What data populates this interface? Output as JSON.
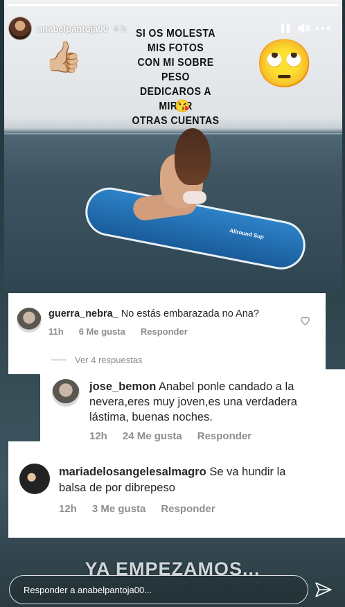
{
  "story": {
    "username": "anabelpantoja00",
    "time": "4 h",
    "caption_lines": [
      "SI OS MOLESTA",
      "MIS FOTOS",
      "CON MI SOBRE PESO",
      "DEDICAROS A MIRAR",
      "OTRAS CUENTAS"
    ],
    "emoji_kiss": "😘",
    "emoji_thumb": "👍🏼",
    "emoji_eyes": "🙄",
    "board_text": "Allround Sup",
    "icons": [
      "pause-icon",
      "mute-icon",
      "more-icon",
      "send-icon",
      "heart-icon"
    ]
  },
  "comments": [
    {
      "user": "guerra_nebra_",
      "text": "No estás embarazada no Ana?",
      "time": "11h",
      "likes": "6 Me gusta",
      "reply": "Responder",
      "view_replies": "Ver 4 respuestas"
    },
    {
      "user": "jose_bemon",
      "text_line1": "Anabel ponle candado a la",
      "text_line2": "nevera,eres muy joven,es una verdadera",
      "text_line3": "lástima, buenas noches.",
      "time": "12h",
      "likes": "24 Me gusta",
      "reply": "Responder"
    },
    {
      "user": "mariadelosangelesalmagro",
      "text_line1": "Se va hundir la",
      "text_line2": "balsa de por dibrepeso",
      "time": "12h",
      "likes": "3 Me gusta",
      "reply": "Responder"
    }
  ],
  "overlay_text": "YA EMPEZAMOS...",
  "reply_placeholder": "Responder a anabelpantoja00..."
}
